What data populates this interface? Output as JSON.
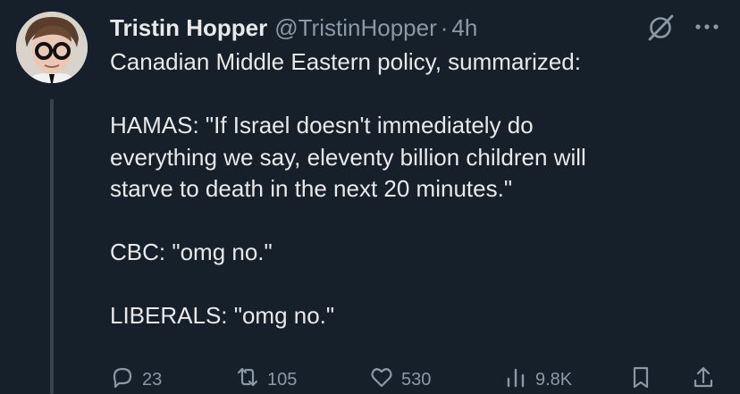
{
  "tweet": {
    "author_name": "Tristin Hopper",
    "author_handle": "@TristinHopper",
    "separator": "·",
    "time": "4h",
    "lines": [
      "Canadian Middle Eastern policy, summarized:",
      "",
      "HAMAS: \"If Israel doesn't immediately do",
      "everything we say, eleventy billion children will",
      "starve to death in the next 20 minutes.\"",
      "",
      "CBC: \"omg no.\"",
      "",
      "LIBERALS: \"omg no.\""
    ]
  },
  "actions": {
    "replies": "23",
    "reposts": "105",
    "likes": "530",
    "views": "9.8K"
  },
  "icons": {
    "grok": "grok-icon",
    "more": "more-icon",
    "reply": "reply-icon",
    "repost": "repost-icon",
    "like": "like-icon",
    "views": "views-icon",
    "bookmark": "bookmark-icon",
    "share": "share-icon"
  },
  "colors": {
    "background": "#15202b",
    "text": "#e7e9ea",
    "secondary": "#8b98a5"
  }
}
